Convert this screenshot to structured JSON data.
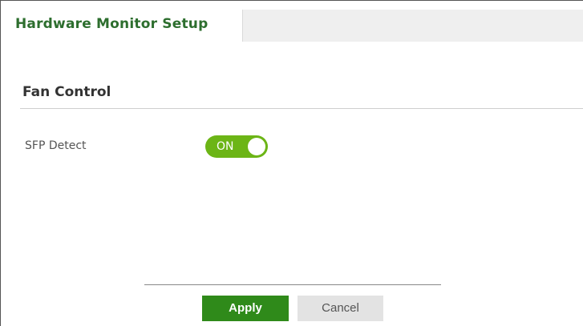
{
  "tabs": [
    {
      "label": "Hardware Monitor Setup",
      "active": true
    }
  ],
  "section": {
    "title": "Fan Control"
  },
  "fields": {
    "sfp_detect": {
      "label": "SFP Detect",
      "state_label": "ON",
      "enabled": true
    }
  },
  "footer": {
    "apply_label": "Apply",
    "cancel_label": "Cancel"
  },
  "colors": {
    "tab_title": "#2d6e2e",
    "toggle_on": "#6cb516",
    "apply_button": "#2f8a1a",
    "cancel_button": "#e3e3e3"
  }
}
